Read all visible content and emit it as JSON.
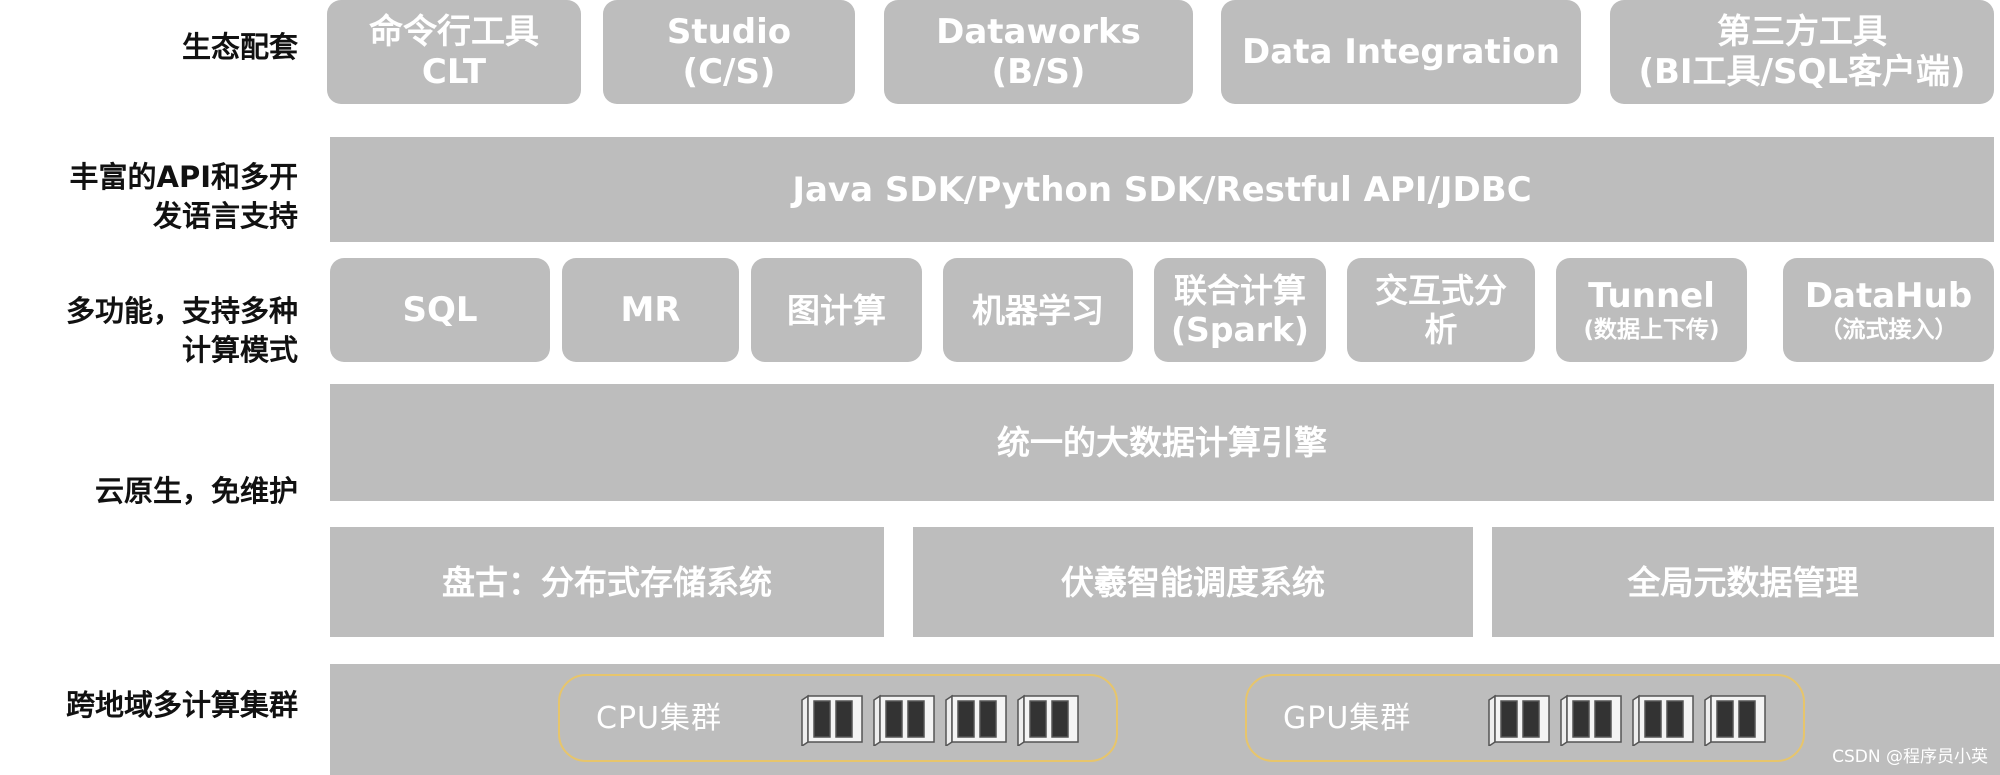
{
  "labels": {
    "ecosystem": "生态配套",
    "api_line1": "丰富的API和多开",
    "api_line2": "发语言支持",
    "multi_line1": "多功能，支持多种",
    "multi_line2": "计算模式",
    "cloud": "云原生，免维护",
    "cluster": "跨地域多计算集群"
  },
  "ecosystem_tools": [
    {
      "line1": "命令行工具",
      "line2": "CLT"
    },
    {
      "line1": "Studio",
      "line2": "(C/S)"
    },
    {
      "line1": "Dataworks",
      "line2": "(B/S)"
    },
    {
      "line1": "Data Integration",
      "line2": ""
    },
    {
      "line1": "第三方工具",
      "line2": "(BI工具/SQL客户端)"
    }
  ],
  "api_bar": "Java SDK/Python SDK/Restful API/JDBC",
  "compute_modes": [
    {
      "line1": "SQL",
      "line2": ""
    },
    {
      "line1": "MR",
      "line2": ""
    },
    {
      "line1": "图计算",
      "line2": ""
    },
    {
      "line1": "机器学习",
      "line2": ""
    },
    {
      "line1": "联合计算",
      "line2": "(Spark)"
    },
    {
      "line1": "交互式分",
      "line2": "析"
    },
    {
      "line1": "Tunnel",
      "line2": "(数据上下传)"
    },
    {
      "line1": "DataHub",
      "line2": "（流式接入）"
    }
  ],
  "engine": "统一的大数据计算引擎",
  "infrastructure": [
    "盘古：分布式存储系统",
    "伏羲智能调度系统",
    "全局元数据管理"
  ],
  "clusters": [
    {
      "label": "CPU集群",
      "server_icon": "server-rack-icon"
    },
    {
      "label": "GPU集群",
      "server_icon": "server-rack-icon"
    }
  ],
  "watermark": "CSDN @程序员小英",
  "colors": {
    "box": "#bdbdbd",
    "text": "#ffffff",
    "label": "#111111",
    "cluster_border": "#e7c56b"
  }
}
